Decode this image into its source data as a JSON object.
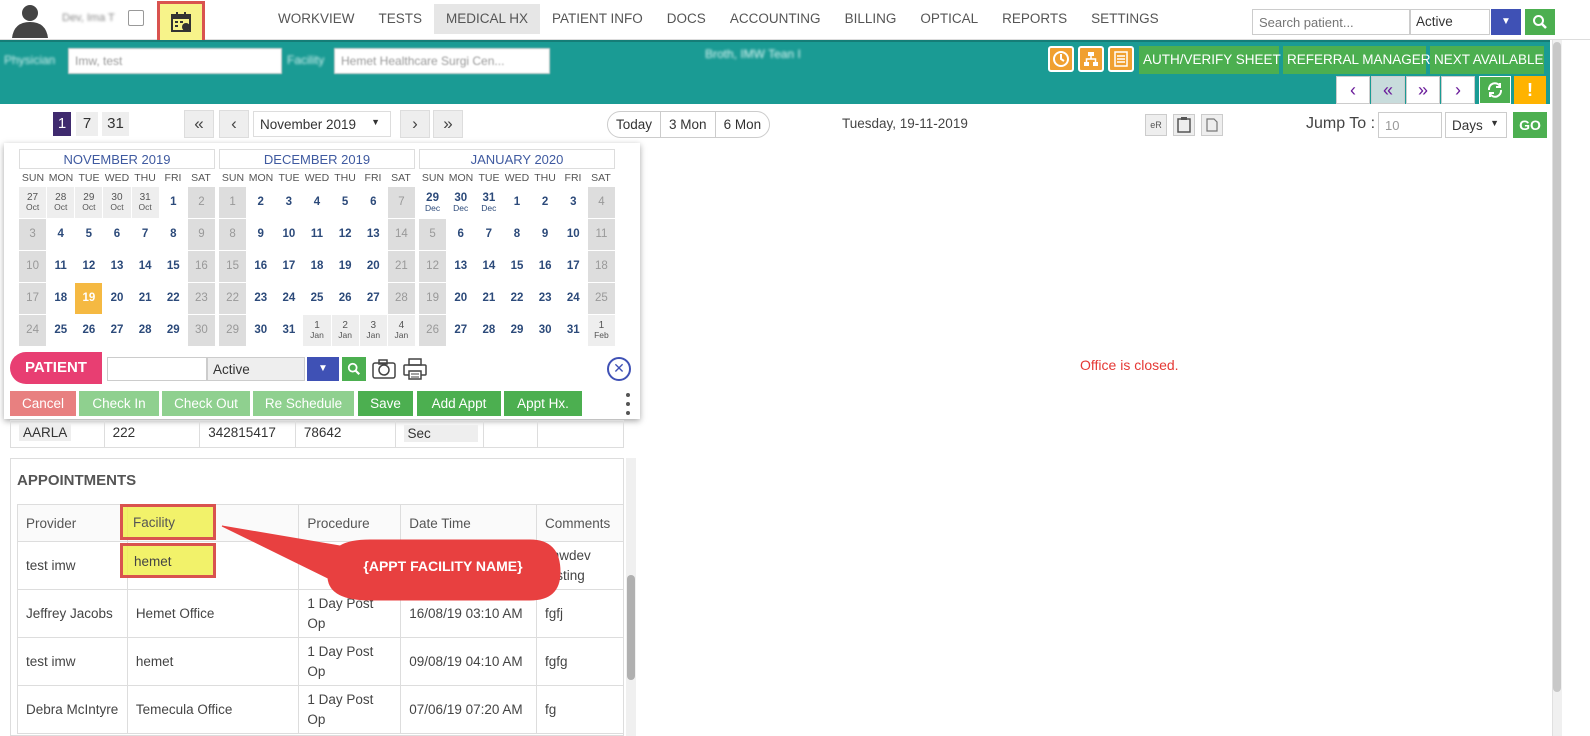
{
  "topbar": {
    "user_name": "Dev, Ima T",
    "nav": [
      "WORKVIEW",
      "TESTS",
      "MEDICAL HX",
      "PATIENT INFO",
      "DOCS",
      "ACCOUNTING",
      "BILLING",
      "OPTICAL",
      "REPORTS",
      "SETTINGS"
    ],
    "active_nav": "MEDICAL HX",
    "search_placeholder": "Search patient...",
    "status_value": "Active"
  },
  "tealbar": {
    "physician_label": "Physician",
    "physician_value": "Imw, test",
    "facility_label": "Facility",
    "facility_value": "Hemet Healthcare Surgi Cen...",
    "center_text": "Broth, IMW Tean I",
    "auth_label": "AUTH/VERIFY SHEET",
    "referral_label": "REFERRAL MANAGER",
    "next_label": "NEXT AVAILABLE",
    "warn_label": "!"
  },
  "toolbar": {
    "views": [
      "1",
      "7",
      "31"
    ],
    "active_view": "1",
    "month": "November 2019",
    "ranges": [
      "Today",
      "3 Mon",
      "6 Mon"
    ],
    "date": "Tuesday, 19-11-2019",
    "er_label": "eR",
    "jump_label": "Jump To :",
    "jump_placeholder": "10",
    "jump_unit": "Days",
    "go_label": "GO"
  },
  "calendar": {
    "dow": [
      "SUN",
      "MON",
      "TUE",
      "WED",
      "THU",
      "FRI",
      "SAT"
    ],
    "months": [
      {
        "title": "NOVEMBER 2019",
        "days": [
          {
            "d": "27",
            "m": "Oct",
            "t": "other"
          },
          {
            "d": "28",
            "m": "Oct",
            "t": "other"
          },
          {
            "d": "29",
            "m": "Oct",
            "t": "other"
          },
          {
            "d": "30",
            "m": "Oct",
            "t": "other"
          },
          {
            "d": "31",
            "m": "Oct",
            "t": "other"
          },
          {
            "d": "1"
          },
          {
            "d": "2",
            "t": "weekend"
          },
          {
            "d": "3",
            "t": "weekend"
          },
          {
            "d": "4"
          },
          {
            "d": "5"
          },
          {
            "d": "6"
          },
          {
            "d": "7"
          },
          {
            "d": "8"
          },
          {
            "d": "9",
            "t": "weekend"
          },
          {
            "d": "10",
            "t": "weekend"
          },
          {
            "d": "11"
          },
          {
            "d": "12"
          },
          {
            "d": "13"
          },
          {
            "d": "14"
          },
          {
            "d": "15"
          },
          {
            "d": "16",
            "t": "weekend"
          },
          {
            "d": "17",
            "t": "weekend"
          },
          {
            "d": "18"
          },
          {
            "d": "19",
            "t": "today"
          },
          {
            "d": "20"
          },
          {
            "d": "21"
          },
          {
            "d": "22"
          },
          {
            "d": "23",
            "t": "weekend"
          },
          {
            "d": "24",
            "t": "weekend"
          },
          {
            "d": "25"
          },
          {
            "d": "26"
          },
          {
            "d": "27"
          },
          {
            "d": "28"
          },
          {
            "d": "29"
          },
          {
            "d": "30",
            "t": "weekend"
          }
        ]
      },
      {
        "title": "DECEMBER 2019",
        "days": [
          {
            "d": "1",
            "t": "weekend"
          },
          {
            "d": "2"
          },
          {
            "d": "3"
          },
          {
            "d": "4"
          },
          {
            "d": "5"
          },
          {
            "d": "6"
          },
          {
            "d": "7",
            "t": "weekend"
          },
          {
            "d": "8",
            "t": "weekend"
          },
          {
            "d": "9"
          },
          {
            "d": "10"
          },
          {
            "d": "11"
          },
          {
            "d": "12"
          },
          {
            "d": "13"
          },
          {
            "d": "14",
            "t": "weekend"
          },
          {
            "d": "15",
            "t": "weekend"
          },
          {
            "d": "16"
          },
          {
            "d": "17"
          },
          {
            "d": "18"
          },
          {
            "d": "19"
          },
          {
            "d": "20"
          },
          {
            "d": "21",
            "t": "weekend"
          },
          {
            "d": "22",
            "t": "weekend"
          },
          {
            "d": "23"
          },
          {
            "d": "24"
          },
          {
            "d": "25"
          },
          {
            "d": "26"
          },
          {
            "d": "27"
          },
          {
            "d": "28",
            "t": "weekend"
          },
          {
            "d": "29",
            "t": "weekend"
          },
          {
            "d": "30"
          },
          {
            "d": "31"
          },
          {
            "d": "1",
            "m": "Jan",
            "t": "other"
          },
          {
            "d": "2",
            "m": "Jan",
            "t": "other"
          },
          {
            "d": "3",
            "m": "Jan",
            "t": "other"
          },
          {
            "d": "4",
            "m": "Jan",
            "t": "other"
          }
        ]
      },
      {
        "title": "JANUARY 2020",
        "days": [
          {
            "d": "29",
            "m": "Dec",
            "t": "otherb"
          },
          {
            "d": "30",
            "m": "Dec",
            "t": "otherb"
          },
          {
            "d": "31",
            "m": "Dec",
            "t": "otherb"
          },
          {
            "d": "1"
          },
          {
            "d": "2"
          },
          {
            "d": "3"
          },
          {
            "d": "4",
            "t": "weekend"
          },
          {
            "d": "5",
            "t": "weekend"
          },
          {
            "d": "6"
          },
          {
            "d": "7"
          },
          {
            "d": "8"
          },
          {
            "d": "9"
          },
          {
            "d": "10"
          },
          {
            "d": "11",
            "t": "weekend"
          },
          {
            "d": "12",
            "t": "weekend"
          },
          {
            "d": "13"
          },
          {
            "d": "14"
          },
          {
            "d": "15"
          },
          {
            "d": "16"
          },
          {
            "d": "17"
          },
          {
            "d": "18",
            "t": "weekend"
          },
          {
            "d": "19",
            "t": "weekend"
          },
          {
            "d": "20"
          },
          {
            "d": "21"
          },
          {
            "d": "22"
          },
          {
            "d": "23"
          },
          {
            "d": "24"
          },
          {
            "d": "25",
            "t": "weekend"
          },
          {
            "d": "26",
            "t": "weekend"
          },
          {
            "d": "27"
          },
          {
            "d": "28"
          },
          {
            "d": "29"
          },
          {
            "d": "30"
          },
          {
            "d": "31"
          },
          {
            "d": "1",
            "m": "Feb",
            "t": "other"
          }
        ]
      }
    ]
  },
  "patient_bar": {
    "label": "PATIENT",
    "status_value": "Active",
    "actions": [
      {
        "label": "Cancel",
        "color": "#e88080"
      },
      {
        "label": "Check In",
        "color": "#8fd08f"
      },
      {
        "label": "Check Out",
        "color": "#8fd08f"
      },
      {
        "label": "Re Schedule",
        "color": "#8fd08f"
      },
      {
        "label": "Save",
        "color": "#4caf50"
      },
      {
        "label": "Add Appt",
        "color": "#4caf50"
      },
      {
        "label": "Appt Hx.",
        "color": "#4caf50"
      }
    ]
  },
  "info_row": [
    "AARLA",
    "222",
    "342815417",
    "78642",
    "Sec",
    "",
    ""
  ],
  "appointments": {
    "title": "APPOINTMENTS",
    "columns": [
      "Provider",
      "Facility",
      "Procedure",
      "Date Time",
      "Comments"
    ],
    "rows": [
      [
        "test imw",
        "hemet",
        "",
        "",
        "imwdev testing"
      ],
      [
        "Jeffrey Jacobs",
        "Hemet Office",
        "1 Day Post Op",
        "16/08/19 03:10 AM",
        "fgfj"
      ],
      [
        "test imw",
        "hemet",
        "1 Day Post Op",
        "09/08/19 04:10 AM",
        "fgfg"
      ],
      [
        "Debra McIntyre",
        "Temecula Office",
        "1 Day Post Op",
        "07/06/19 07:20 AM",
        "fg"
      ]
    ]
  },
  "callout": "{APPT FACILITY NAME}",
  "office_closed": "Office is closed.",
  "colors": {
    "teal": "#1a9b94",
    "green": "#4caf50",
    "blue": "#3f51b5",
    "pink": "#e83e72",
    "red": "#d9534f"
  }
}
